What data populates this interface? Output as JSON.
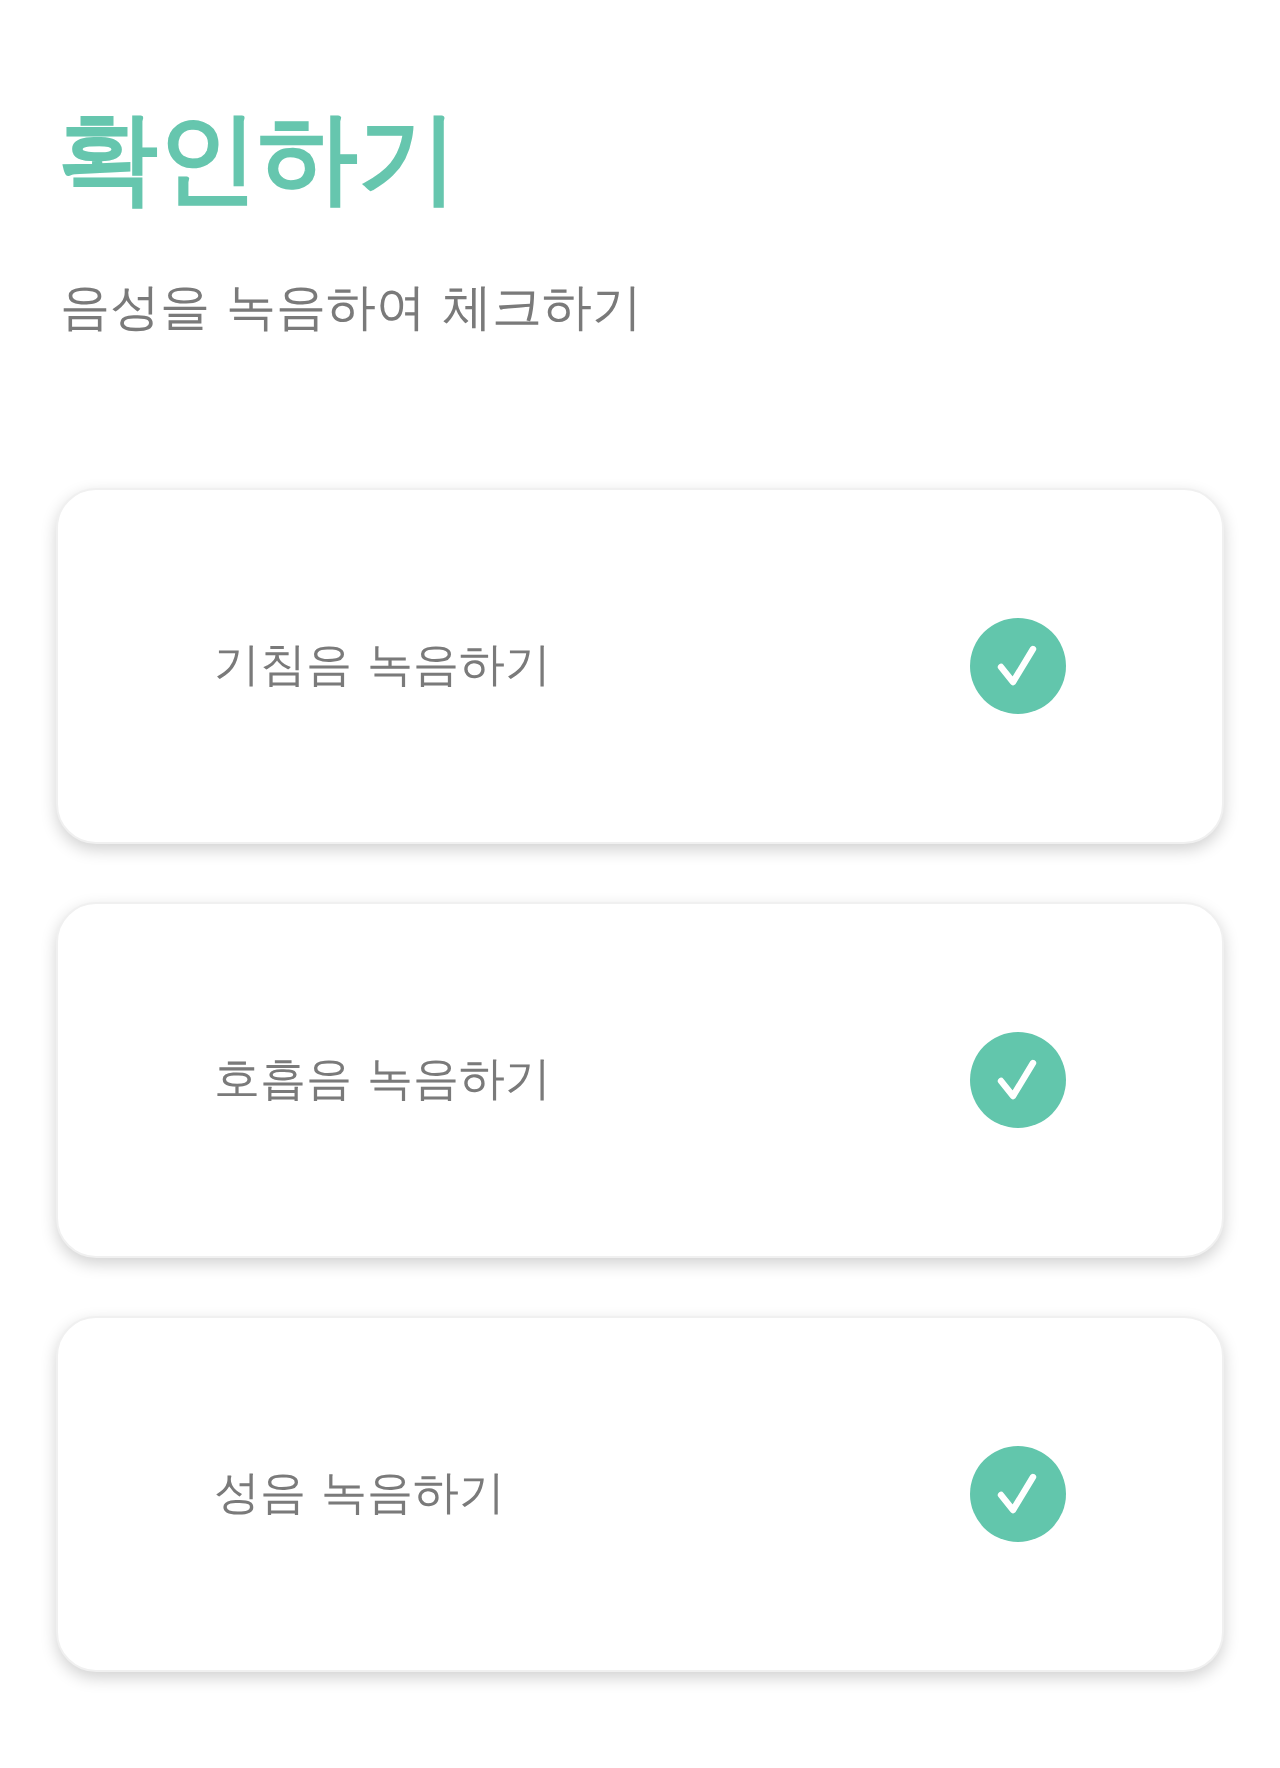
{
  "title": "확인하기",
  "subtitle": "음성을 녹음하여 체크하기",
  "tasks": [
    {
      "label": "기침음 녹음하기",
      "checked": true
    },
    {
      "label": "호흡음 녹음하기",
      "checked": true
    },
    {
      "label": "성음 녹음하기",
      "checked": true
    }
  ]
}
